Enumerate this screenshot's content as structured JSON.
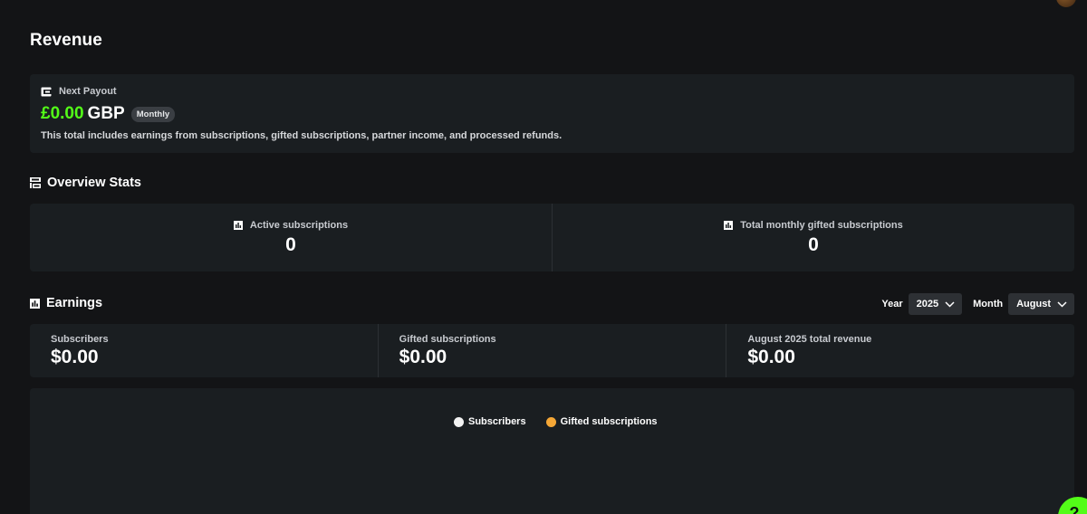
{
  "header": {
    "title": "Revenue"
  },
  "payout": {
    "label": "Next Payout",
    "amount": "£0.00",
    "currency": "GBP",
    "badge": "Monthly",
    "description": "This total includes earnings from subscriptions, gifted subscriptions, partner income, and processed refunds."
  },
  "overview": {
    "title": "Overview Stats",
    "stats": [
      {
        "label": "Active subscriptions",
        "value": "0"
      },
      {
        "label": "Total monthly gifted subscriptions",
        "value": "0"
      }
    ]
  },
  "earnings": {
    "title": "Earnings",
    "year_label": "Year",
    "year_value": "2025",
    "month_label": "Month",
    "month_value": "August",
    "stats": [
      {
        "label": "Subscribers",
        "value": "$0.00"
      },
      {
        "label": "Gifted subscriptions",
        "value": "$0.00"
      },
      {
        "label": "August 2025 total revenue",
        "value": "$0.00"
      }
    ]
  },
  "chart_legend": [
    {
      "name": "Subscribers",
      "color": "#f2f2f2"
    },
    {
      "name": "Gifted subscriptions",
      "color": "#f5a736"
    }
  ],
  "colors": {
    "accent": "#53fc18",
    "background": "#131416",
    "card": "#1a1e21"
  },
  "icons": {
    "payout": "wallet-icon",
    "overview": "dashboard-icon",
    "stats": "chart-icon",
    "dropdown": "chevron-down-icon",
    "help": "help-icon"
  }
}
